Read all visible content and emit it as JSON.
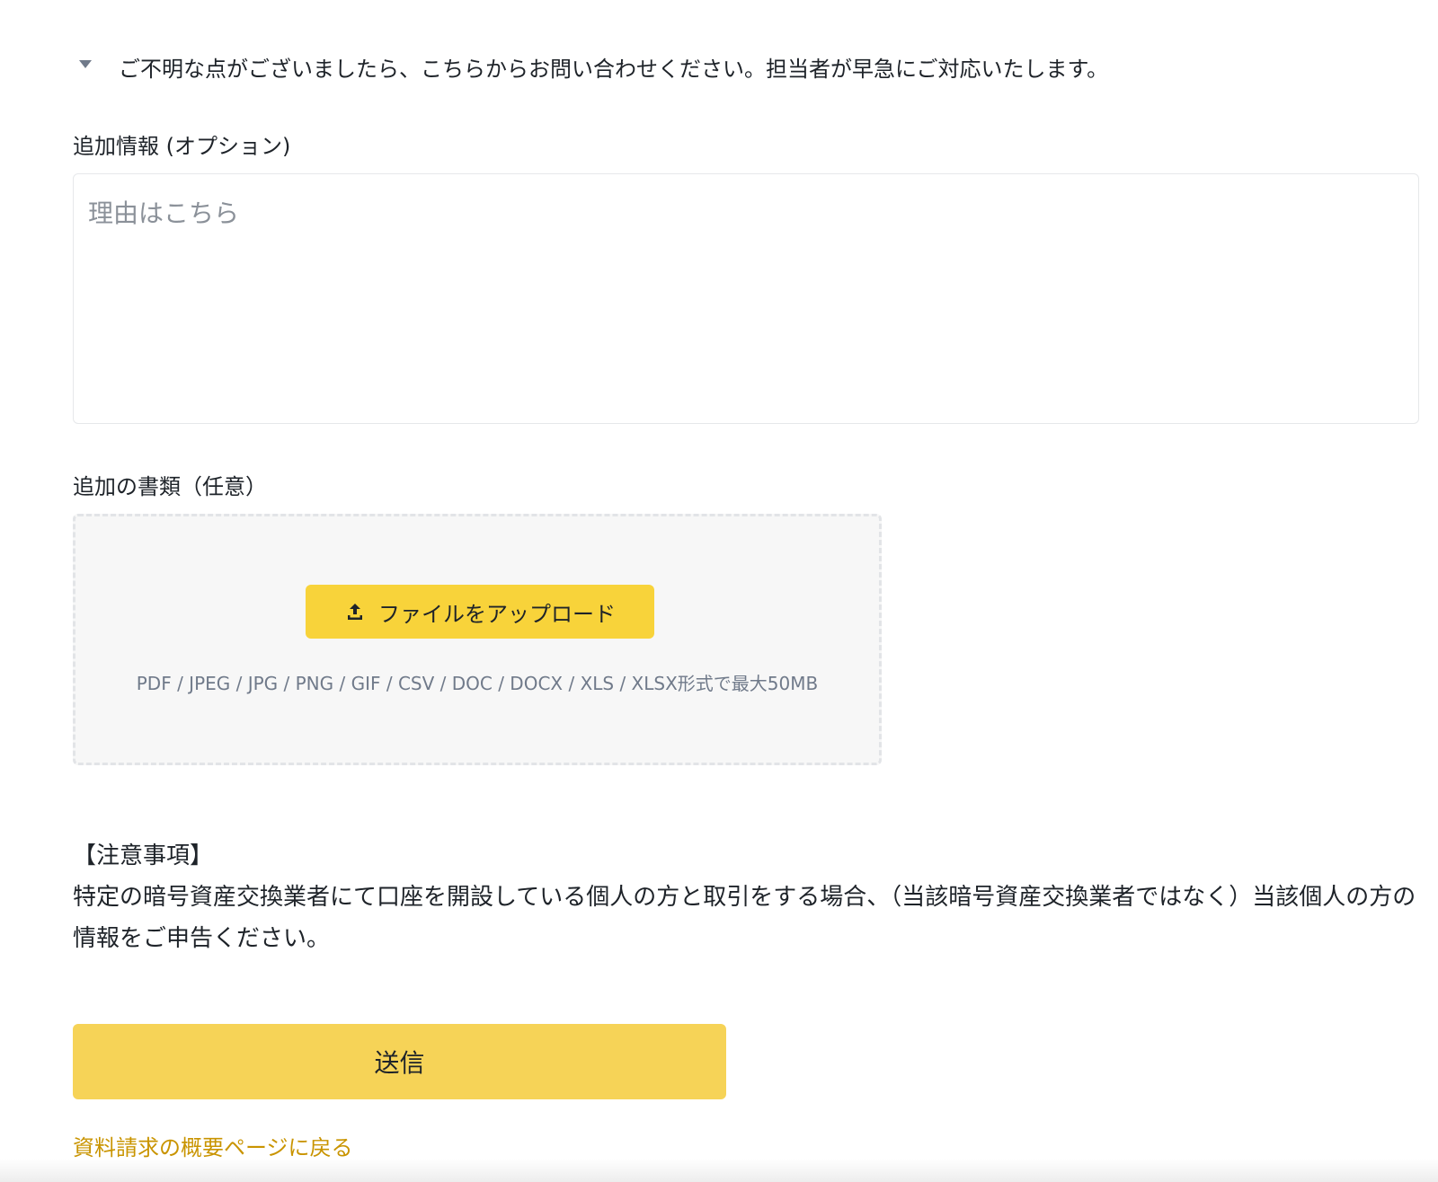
{
  "disclosure": {
    "text": "ご不明な点がございましたら、こちらからお問い合わせください。担当者が早急にご対応いたします。",
    "icon": "caret-down-icon"
  },
  "additional_info": {
    "label": "追加情報 (オプション)",
    "placeholder": "理由はこちら",
    "value": ""
  },
  "additional_documents": {
    "label": "追加の書類（任意）",
    "upload_button_label": "ファイルをアップロード",
    "upload_icon": "upload-icon",
    "formats_hint": "PDF / JPEG / JPG / PNG / GIF / CSV / DOC / DOCX / XLS / XLSX形式で最大50MB"
  },
  "notice": {
    "title": "【注意事項】",
    "body": "特定の暗号資産交換業者にて口座を開設している個人の方と取引をする場合、（当該暗号資産交換業者ではなく）当該個人の方の情報をご申告ください。"
  },
  "submit_label": "送信",
  "back_link_label": "資料請求の概要ページに戻る",
  "colors": {
    "accent": "#f8d33a",
    "submit": "#f6d357",
    "link": "#c99400",
    "text": "#1e2329",
    "muted": "#707a8a"
  }
}
